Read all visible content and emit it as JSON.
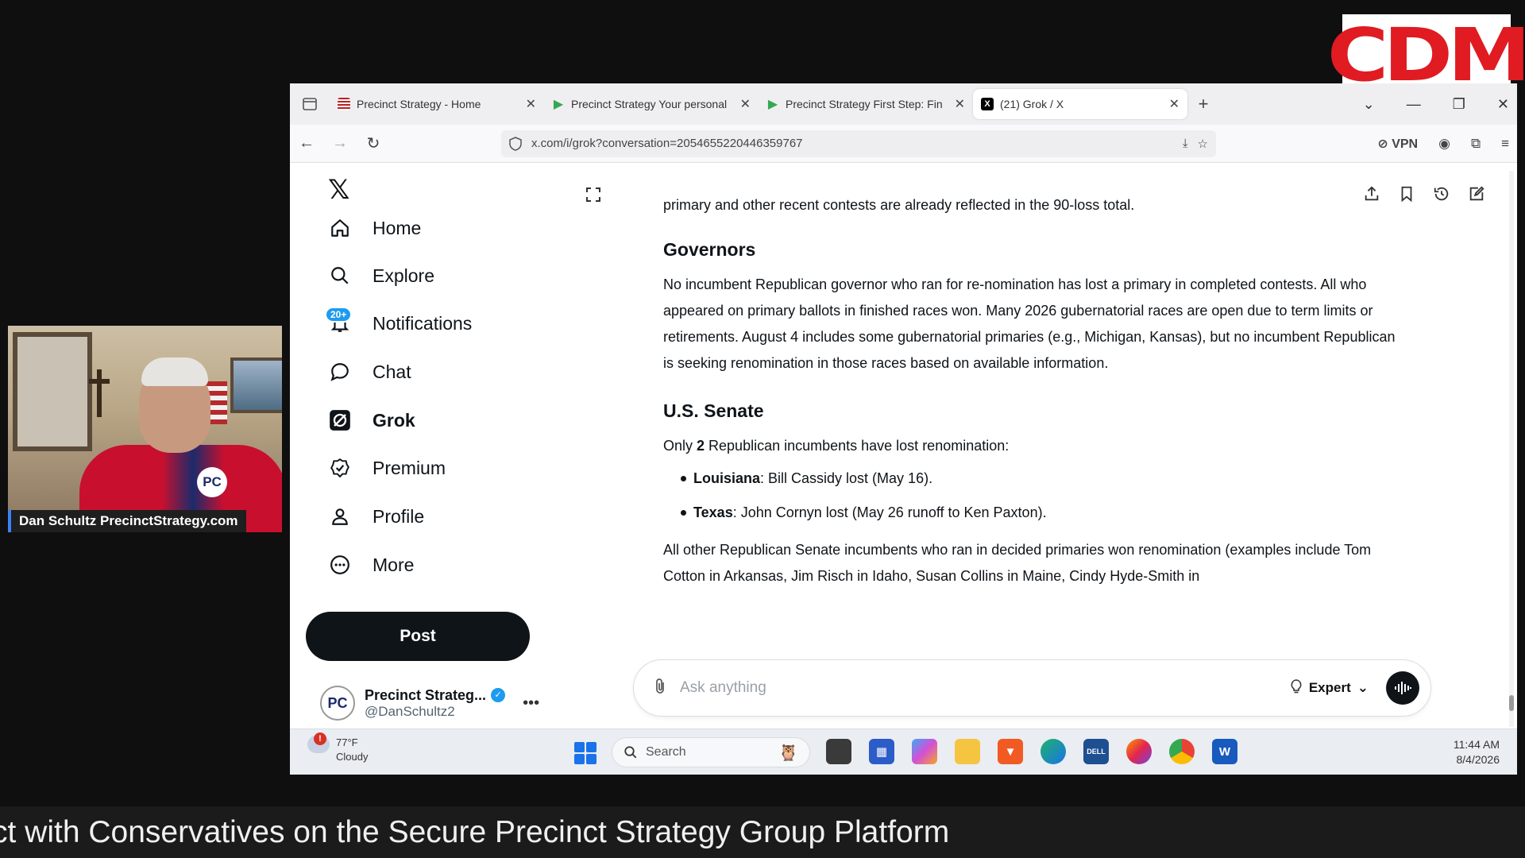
{
  "overlay": {
    "logo_text": "CDM",
    "webcam_caption": "Dan Schultz PrecinctStrategy.com",
    "ticker_text": "ct with Conservatives on the Secure Precinct Strategy Group Platform"
  },
  "browser": {
    "tabs": [
      {
        "title": "Precinct Strategy - Home",
        "active": false
      },
      {
        "title": "Precinct Strategy Your personal",
        "active": false
      },
      {
        "title": "Precinct Strategy First Step: Fin",
        "active": false
      },
      {
        "title": "(21) Grok / X",
        "active": true
      }
    ],
    "url": "x.com/i/grok?conversation=2054655220446359767",
    "vpn_label": "VPN"
  },
  "sidebar": {
    "items": [
      {
        "label": "Home",
        "icon": "home-icon"
      },
      {
        "label": "Explore",
        "icon": "search-icon"
      },
      {
        "label": "Notifications",
        "icon": "bell-icon",
        "badge": "20+"
      },
      {
        "label": "Chat",
        "icon": "chat-bubble-icon"
      },
      {
        "label": "Grok",
        "icon": "grok-icon"
      },
      {
        "label": "Premium",
        "icon": "premium-icon"
      },
      {
        "label": "Profile",
        "icon": "person-icon"
      },
      {
        "label": "More",
        "icon": "more-circle-icon"
      }
    ],
    "post_label": "Post",
    "account": {
      "avatar_text": "PC",
      "name": "Precinct Strateg...",
      "handle": "@DanSchultz2"
    }
  },
  "content": {
    "intro": "primary and other recent contests are already reflected in the 90-loss total.",
    "governors_heading": "Governors",
    "governors_text": "No incumbent Republican governor who ran for re-nomination has lost a primary in completed contests. All who appeared on primary ballots in finished races won. Many 2026 gubernatorial races are open due to term limits or retirements. August 4 includes some gubernatorial primaries (e.g., Michigan, Kansas), but no incumbent Republican is seeking renomination in those races based on available information.",
    "senate_heading": "U.S. Senate",
    "senate_lead_pre": "Only ",
    "senate_lead_bold": "2",
    "senate_lead_post": " Republican incumbents have lost renomination:",
    "senate_items": [
      {
        "bold": "Louisiana",
        "text": ": Bill Cassidy lost (May 16)."
      },
      {
        "bold": "Texas",
        "text": ": John Cornyn lost (May 26 runoff to Ken Paxton)."
      }
    ],
    "senate_tail": "All other Republican Senate incumbents who ran in decided primaries won renomination (examples include Tom Cotton in Arkansas, Jim Risch in Idaho, Susan Collins in Maine, Cindy Hyde-Smith in"
  },
  "composer": {
    "placeholder": "Ask anything",
    "mode_label": "Expert"
  },
  "taskbar": {
    "weather_temp": "77°F",
    "weather_desc": "Cloudy",
    "weather_alert": "!",
    "search_label": "Search",
    "time": "11:44 AM",
    "date": "8/4/2026"
  },
  "colors": {
    "logo_red": "#e01b22",
    "x_blue": "#1d9bf0",
    "text_dark": "#0f1419"
  }
}
